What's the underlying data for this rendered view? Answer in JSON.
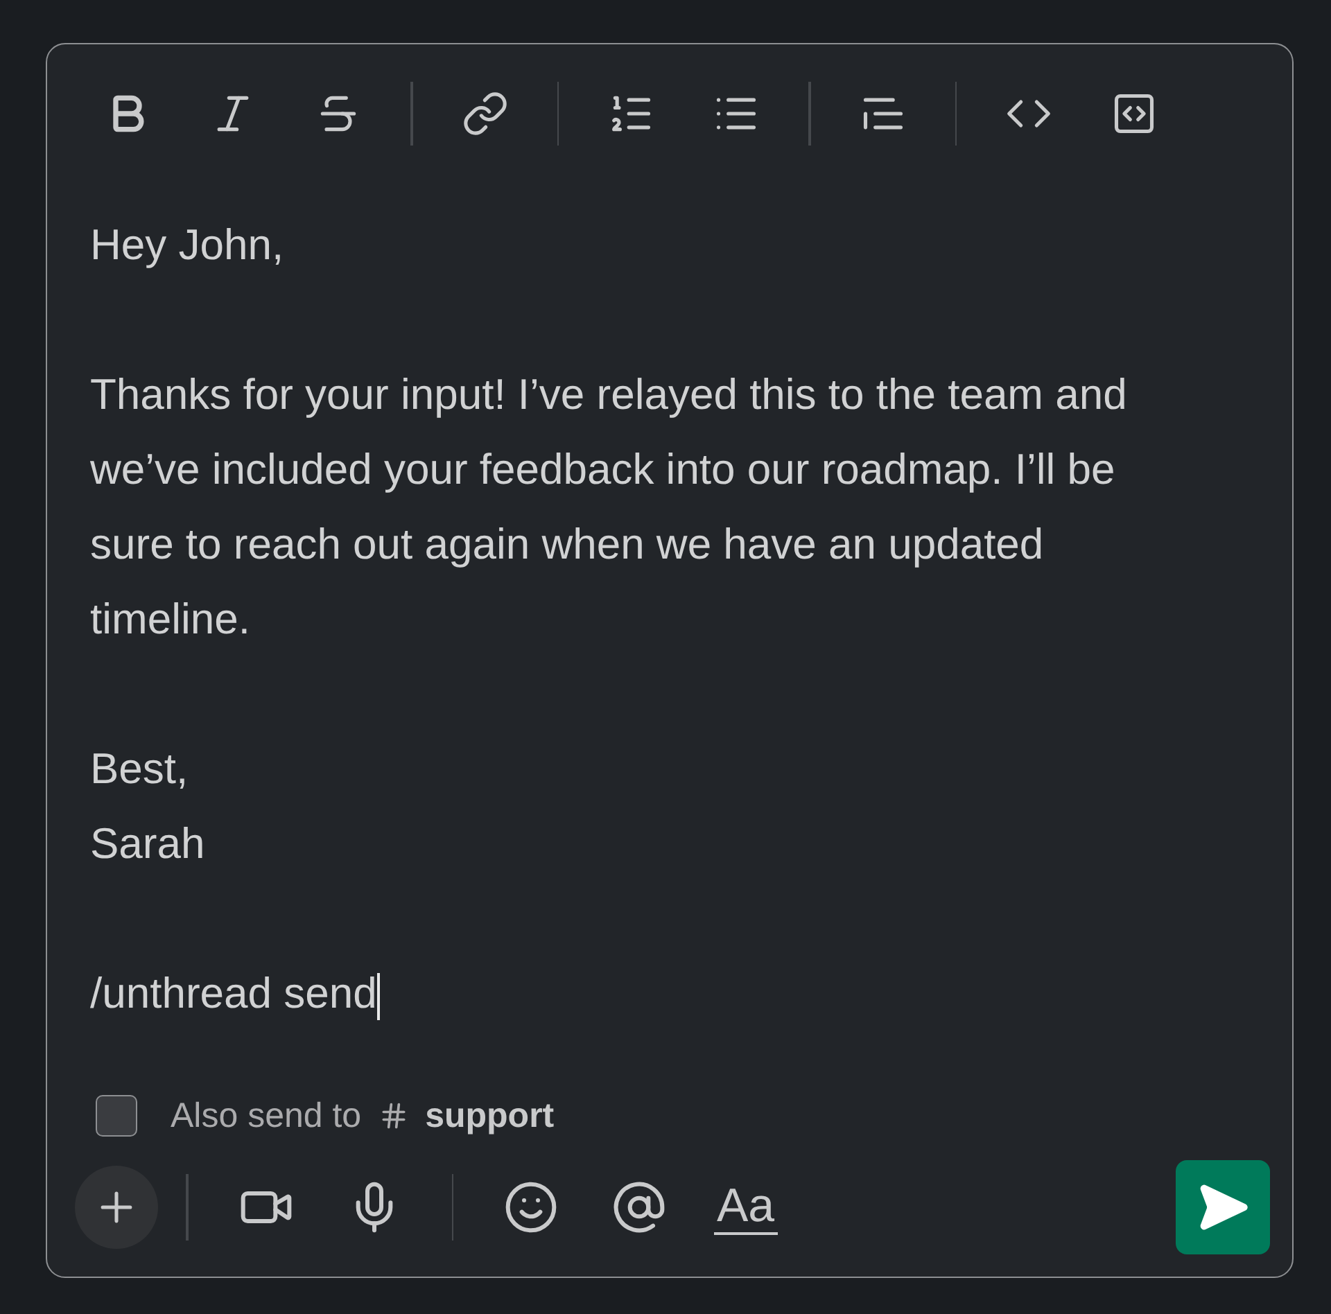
{
  "toolbar": [
    {
      "kind": "bold"
    },
    {
      "kind": "italic"
    },
    {
      "kind": "strike"
    },
    {
      "kind": "divider"
    },
    {
      "kind": "link"
    },
    {
      "kind": "divider"
    },
    {
      "kind": "ordered"
    },
    {
      "kind": "bullet"
    },
    {
      "kind": "divider"
    },
    {
      "kind": "quote"
    },
    {
      "kind": "divider"
    },
    {
      "kind": "code"
    },
    {
      "kind": "codeblock"
    }
  ],
  "message": [
    [
      "Hey John,"
    ],
    [
      "Thanks for your input! I’ve relayed this to the team and we’ve included your feedback into our roadmap. I’ll be sure to reach out again when we have an updated timeline."
    ],
    [
      "Best,",
      "Sarah"
    ],
    [
      "/unthread send"
    ]
  ],
  "also_send": {
    "checked": false,
    "label": "Also send to",
    "channel": "support"
  },
  "bottom_bar": [
    {
      "kind": "plus"
    },
    {
      "kind": "divider"
    },
    {
      "kind": "video"
    },
    {
      "kind": "mic"
    },
    {
      "kind": "divider"
    },
    {
      "kind": "emoji"
    },
    {
      "kind": "mention"
    },
    {
      "kind": "format",
      "label": "Aa"
    }
  ]
}
